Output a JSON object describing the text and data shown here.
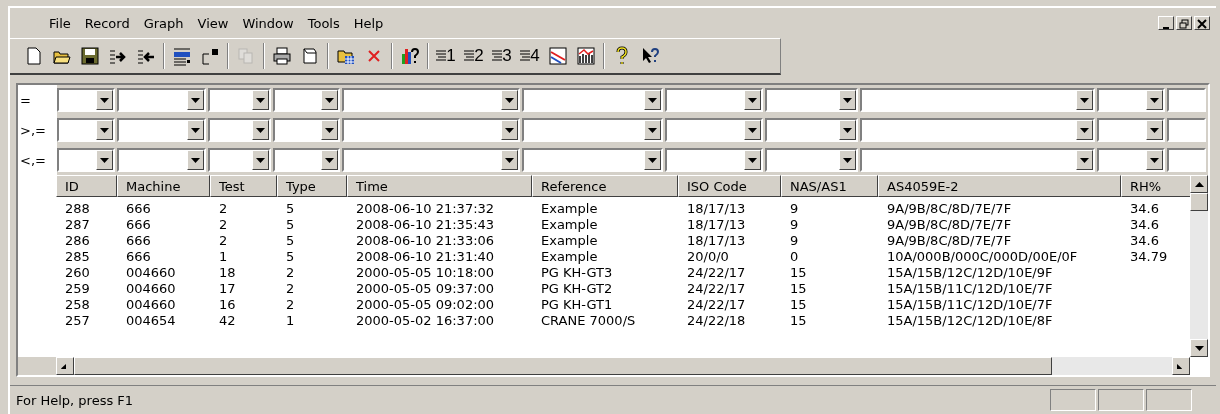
{
  "menu": [
    "File",
    "Record",
    "Graph",
    "View",
    "Window",
    "Tools",
    "Help"
  ],
  "toolbar": [
    {
      "kind": "new"
    },
    {
      "kind": "open"
    },
    {
      "kind": "save"
    },
    {
      "kind": "export"
    },
    {
      "kind": "import"
    },
    {
      "kind": "sep"
    },
    {
      "kind": "view"
    },
    {
      "kind": "window"
    },
    {
      "kind": "sep"
    },
    {
      "kind": "copy",
      "disabled": true
    },
    {
      "kind": "sep"
    },
    {
      "kind": "print"
    },
    {
      "kind": "preview"
    },
    {
      "kind": "sep"
    },
    {
      "kind": "folder"
    },
    {
      "kind": "delete"
    },
    {
      "kind": "sep"
    },
    {
      "kind": "chartq"
    },
    {
      "kind": "sep"
    },
    {
      "kind": "list",
      "label": "1"
    },
    {
      "kind": "list",
      "label": "2"
    },
    {
      "kind": "list",
      "label": "3"
    },
    {
      "kind": "list",
      "label": "4"
    },
    {
      "kind": "linechart"
    },
    {
      "kind": "barchart"
    },
    {
      "kind": "sep"
    },
    {
      "kind": "help"
    },
    {
      "kind": "contexthelp"
    }
  ],
  "filters": [
    "=",
    ">,=",
    "<,="
  ],
  "table": {
    "columns": [
      "ID",
      "Machine",
      "Test",
      "Type",
      "Time",
      "Reference",
      "ISO Code",
      "NAS/AS1",
      "AS4059E-2",
      "RH%"
    ],
    "rows": [
      [
        "288",
        "666",
        "2",
        "5",
        "2008-06-10 21:37:32",
        "Example",
        "18/17/13",
        "9",
        "9A/9B/8C/8D/7E/7F",
        "34.6"
      ],
      [
        "287",
        "666",
        "2",
        "5",
        "2008-06-10 21:35:43",
        "Example",
        "18/17/13",
        "9",
        "9A/9B/8C/8D/7E/7F",
        "34.6"
      ],
      [
        "286",
        "666",
        "2",
        "5",
        "2008-06-10 21:33:06",
        "Example",
        "18/17/13",
        "9",
        "9A/9B/8C/8D/7E/7F",
        "34.6"
      ],
      [
        "285",
        "666",
        "1",
        "5",
        "2008-06-10 21:31:40",
        "Example",
        "20/0/0",
        "0",
        "10A/000B/000C/000D/00E/0F",
        "34.79"
      ],
      [
        "260",
        "004660",
        "18",
        "2",
        "2000-05-05 10:18:00",
        "PG KH-GT3",
        "24/22/17",
        "15",
        "15A/15B/12C/12D/10E/9F",
        ""
      ],
      [
        "259",
        "004660",
        "17",
        "2",
        "2000-05-05 09:37:00",
        "PG KH-GT2",
        "24/22/17",
        "15",
        "15A/15B/11C/12D/10E/7F",
        ""
      ],
      [
        "258",
        "004660",
        "16",
        "2",
        "2000-05-05 09:02:00",
        "PG KH-GT1",
        "24/22/17",
        "15",
        "15A/15B/11C/12D/10E/7F",
        ""
      ],
      [
        "257",
        "004654",
        "42",
        "1",
        "2000-05-02 16:37:00",
        "CRANE 7000/S",
        "24/22/18",
        "15",
        "15A/15B/12C/12D/10E/8F",
        ""
      ]
    ]
  },
  "status_bar": "For Help, press F1"
}
